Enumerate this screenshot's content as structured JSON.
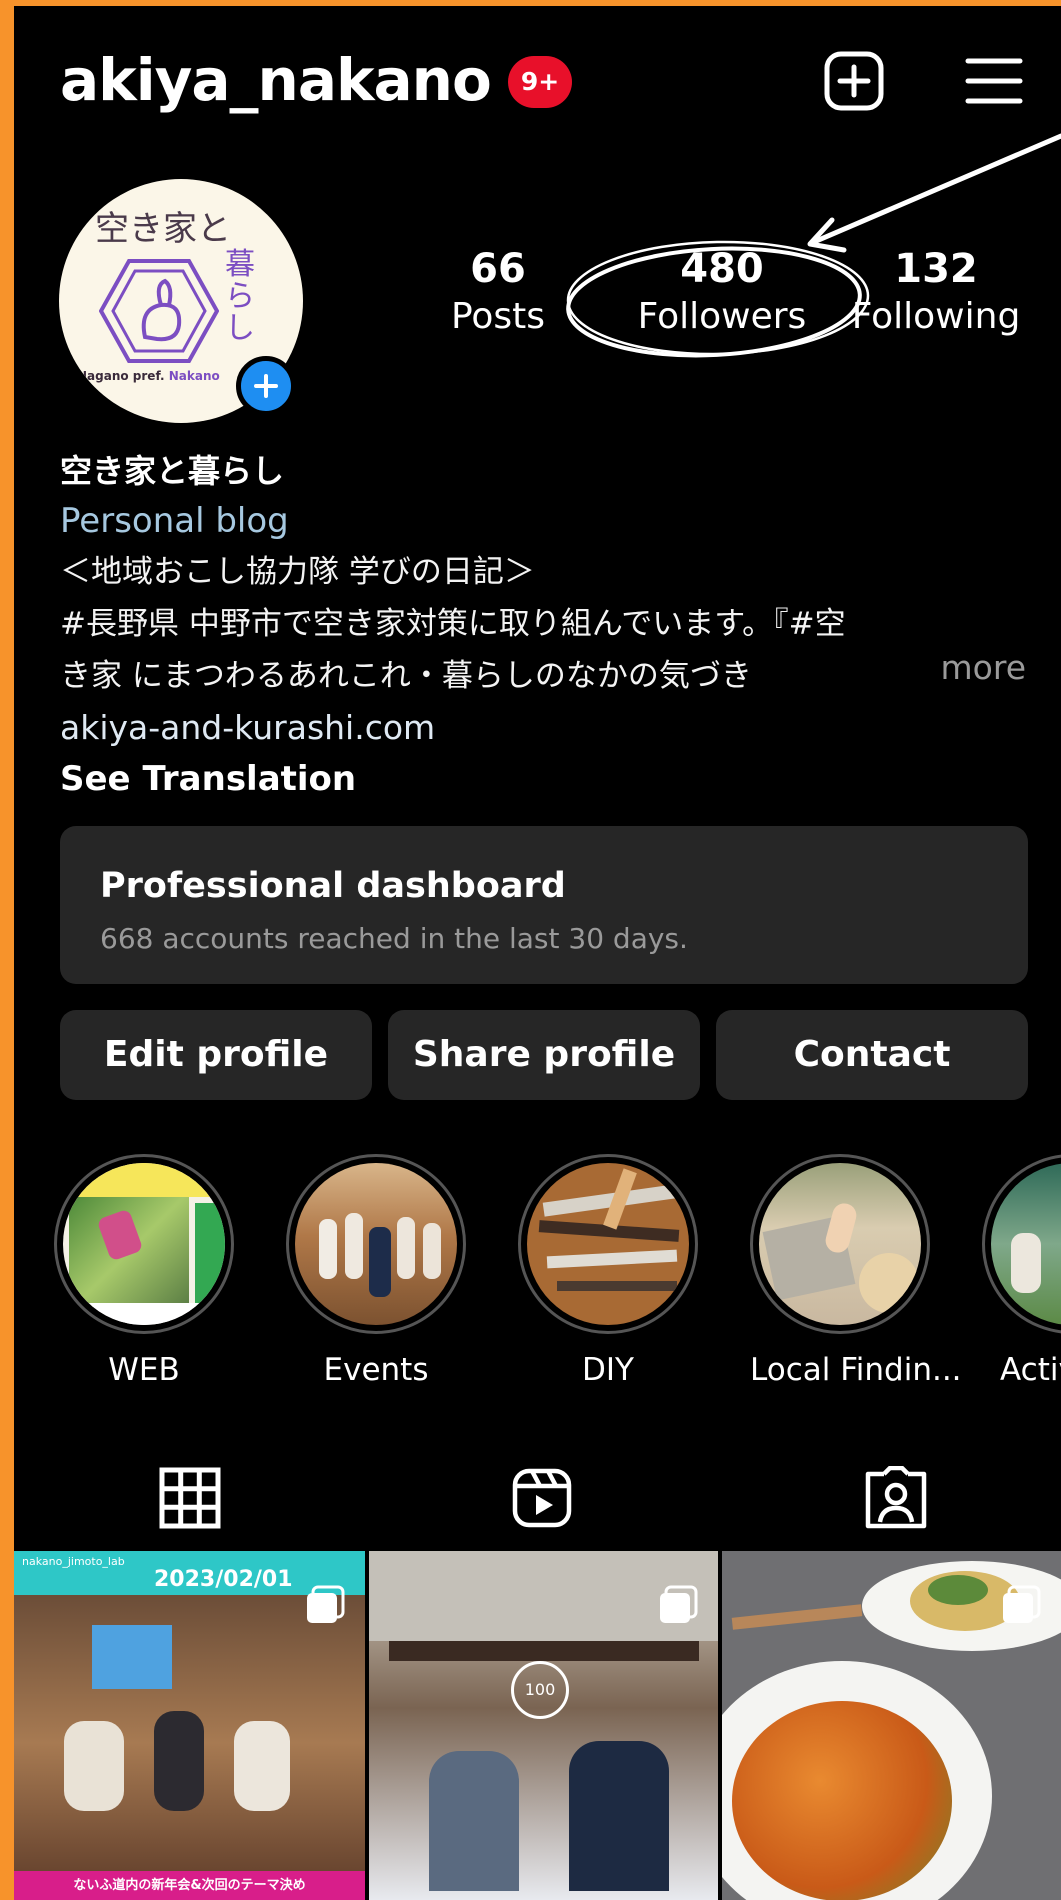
{
  "header": {
    "username": "akiya_nakano",
    "notification_badge": "9+"
  },
  "avatar": {
    "title": "空き家と",
    "subtitle": "暮らし",
    "footer_main": "Nagano pref.",
    "footer_accent": "Nakano"
  },
  "stats": [
    {
      "number": "66",
      "label": "Posts"
    },
    {
      "number": "480",
      "label": "Followers"
    },
    {
      "number": "132",
      "label": "Following"
    }
  ],
  "bio": {
    "name": "空き家と暮らし",
    "category": "Personal blog",
    "lines": [
      "＜地域おこし協力隊 学びの日記＞",
      "#長野県 中野市で空き家対策に取り組んでいます。『#空",
      "き家 にまつわるあれこれ・暮らしのなかの気づき"
    ],
    "more": "more",
    "link": "akiya-and-kurashi.com",
    "translate": "See Translation"
  },
  "dashboard": {
    "title": "Professional dashboard",
    "subtitle": "668 accounts reached in the last 30 days."
  },
  "actions": {
    "edit": "Edit profile",
    "share": "Share profile",
    "contact": "Contact"
  },
  "highlights": [
    {
      "label": "WEB"
    },
    {
      "label": "Events"
    },
    {
      "label": "DIY"
    },
    {
      "label": "Local Findin..."
    },
    {
      "label": "Activ"
    }
  ],
  "tabs": [
    "grid",
    "reels",
    "tagged"
  ],
  "posts": [
    {
      "repost_user": "nakano_jimoto_lab",
      "date_text": "2023/02/01",
      "caption": "ないふ道内の新年会&次回のテーマ決め"
    },
    {
      "stamp": "100"
    },
    {}
  ],
  "colors": {
    "background": "#000000",
    "surface": "#262626",
    "badge": "#e8102a",
    "accent_blue": "#1e8ef2",
    "frame": "#f7932b"
  }
}
